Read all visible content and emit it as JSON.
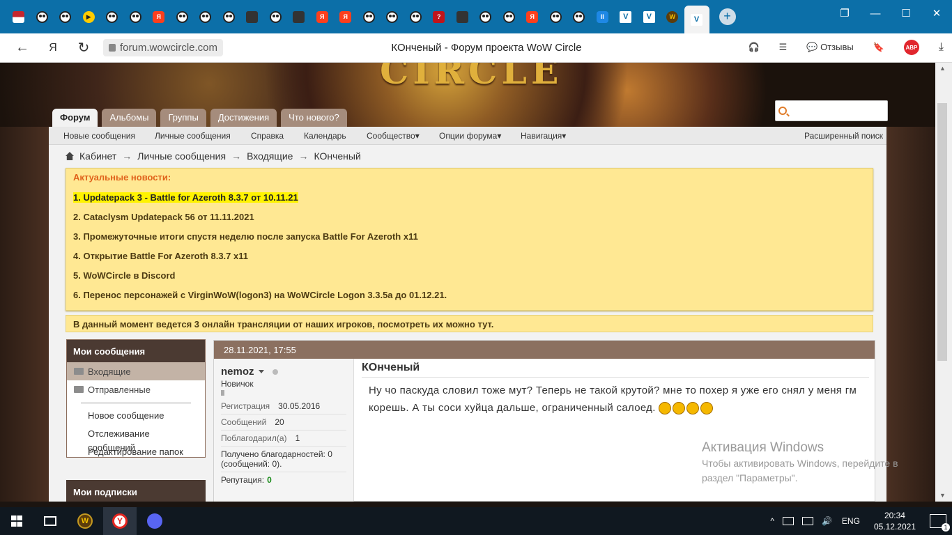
{
  "browser": {
    "url": "forum.wowcircle.com",
    "page_title": "КОнченый - Форум проекта WoW Circle",
    "reviews_label": "Отзывы",
    "abp_label": "ABP",
    "yandex_label": "Я"
  },
  "tabs": [
    {
      "icon": "flag-icon",
      "style": "flag",
      "text": ""
    },
    {
      "icon": "panda-icon",
      "style": "panda",
      "text": ""
    },
    {
      "icon": "panda-icon",
      "style": "panda",
      "text": ""
    },
    {
      "icon": "play-icon",
      "style": "play",
      "text": "▶"
    },
    {
      "icon": "panda-icon",
      "style": "panda",
      "text": ""
    },
    {
      "icon": "panda-icon",
      "style": "panda",
      "text": ""
    },
    {
      "icon": "yandex-icon",
      "style": "ya",
      "text": "Я"
    },
    {
      "icon": "panda-icon",
      "style": "panda",
      "text": ""
    },
    {
      "icon": "panda-icon",
      "style": "panda",
      "text": ""
    },
    {
      "icon": "panda-icon",
      "style": "panda",
      "text": ""
    },
    {
      "icon": "site-icon",
      "style": "sq",
      "text": ""
    },
    {
      "icon": "panda-icon",
      "style": "panda",
      "text": ""
    },
    {
      "icon": "site-icon",
      "style": "sq",
      "text": ""
    },
    {
      "icon": "yandex-icon",
      "style": "ya",
      "text": "Я"
    },
    {
      "icon": "yandex-icon",
      "style": "ya",
      "text": "Я"
    },
    {
      "icon": "panda-icon",
      "style": "panda",
      "text": ""
    },
    {
      "icon": "panda-icon",
      "style": "panda",
      "text": ""
    },
    {
      "icon": "panda-icon",
      "style": "panda",
      "text": ""
    },
    {
      "icon": "question-icon",
      "style": "red",
      "text": "?"
    },
    {
      "icon": "site-icon",
      "style": "sq",
      "text": ""
    },
    {
      "icon": "panda-icon",
      "style": "panda",
      "text": ""
    },
    {
      "icon": "panda-icon",
      "style": "panda",
      "text": ""
    },
    {
      "icon": "yandex-icon",
      "style": "ya",
      "text": "Я"
    },
    {
      "icon": "panda-icon",
      "style": "panda",
      "text": ""
    },
    {
      "icon": "panda-icon",
      "style": "panda",
      "text": ""
    },
    {
      "icon": "pause-icon",
      "style": "blue",
      "text": "II"
    },
    {
      "icon": "wv-icon",
      "style": "wv",
      "text": "V"
    },
    {
      "icon": "wv-icon",
      "style": "wv",
      "text": "V"
    },
    {
      "icon": "wow-icon",
      "style": "wow",
      "text": "W"
    }
  ],
  "forum": {
    "nav_tabs": [
      "Форум",
      "Альбомы",
      "Группы",
      "Достижения",
      "Что нового?"
    ],
    "subnav": [
      "Новые сообщения",
      "Личные сообщения",
      "Справка",
      "Календарь",
      "Сообщество▾",
      "Опции форума▾",
      "Навигация▾"
    ],
    "advanced_search": "Расширенный поиск",
    "breadcrumb": [
      "Кабинет",
      "Личные сообщения",
      "Входящие",
      "КОнченый"
    ],
    "news": {
      "heading": "Актуальные новости:",
      "items": [
        "1. Updatepack 3 - Battle for Azeroth 8.3.7 от 10.11.21",
        "2. Cataclysm Updatepack 56 от 11.11.2021",
        "3. Промежуточные итоги спустя неделю после запуска Battle For Azeroth x11",
        "4. Открытие Battle For Azeroth 8.3.7 x11",
        "5. WoWCircle в Discord",
        "6. Перенос персонажей с VirginWoW(logon3) на WoWCircle Logon 3.3.5a до 01.12.21."
      ]
    },
    "stream_notice": "В данный момент ведется 3 онлайн трансляции от наших игроков, посмотреть их можно тут.",
    "sidebar": {
      "title": "Мои сообщения",
      "folders": [
        "Входящие",
        "Отправленные"
      ],
      "links": [
        "Новое сообщение",
        "Отслеживание сообщений",
        "Редактирование папок"
      ],
      "subscriptions_title": "Мои подписки"
    },
    "post": {
      "date": "28.11.2021, 17:55",
      "author": "nemoz",
      "rank": "Новичок",
      "stats": [
        {
          "label": "Регистрация",
          "value": "30.05.2016"
        },
        {
          "label": "Сообщений",
          "value": "20"
        },
        {
          "label": "Поблагодарил(а)",
          "value": "1"
        }
      ],
      "thanks_text": "Получено благодарностей: 0 (сообщений: 0).",
      "reputation_label": "Репутация:",
      "reputation_value": "0",
      "title": "КОнченый",
      "text": "Ну чо паскуда словил тоже мут? Теперь не такой крутой? мне то похер я уже его снял у меня гм корешь. А ты соси хуйца дальше, ограниченный салоед."
    }
  },
  "windows_watermark": {
    "title": "Активация Windows",
    "line1": "Чтобы активировать Windows, перейдите в",
    "line2": "раздел \"Параметры\"."
  },
  "taskbar": {
    "time": "20:34",
    "date": "05.12.2021",
    "lang": "ENG",
    "notif_count": "1",
    "wow_label": "W",
    "yandex_label": "Y"
  }
}
